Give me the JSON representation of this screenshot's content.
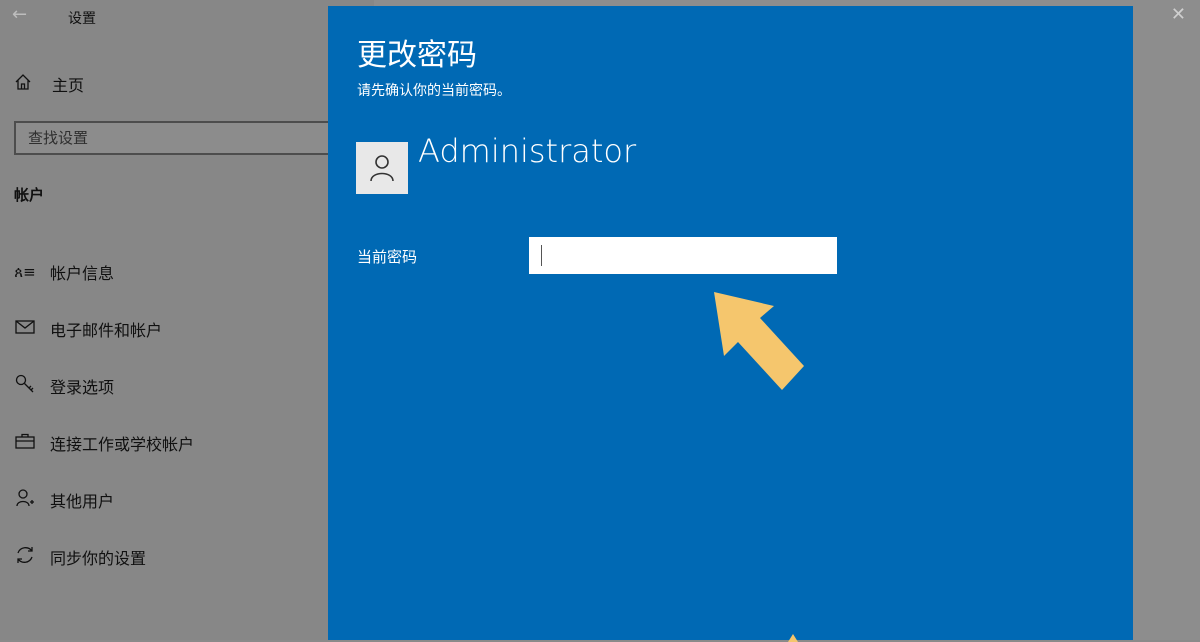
{
  "window": {
    "title": "设置",
    "back_icon": "back-arrow-icon",
    "close_icon": "close-icon"
  },
  "sidebar": {
    "home_label": "主页",
    "search_placeholder": "查找设置",
    "section_title": "帐户",
    "items": [
      {
        "icon": "account-info-icon",
        "label": "帐户信息"
      },
      {
        "icon": "mail-icon",
        "label": "电子邮件和帐户"
      },
      {
        "icon": "key-icon",
        "label": "登录选项"
      },
      {
        "icon": "briefcase-icon",
        "label": "连接工作或学校帐户"
      },
      {
        "icon": "add-user-icon",
        "label": "其他用户"
      },
      {
        "icon": "sync-icon",
        "label": "同步你的设置"
      }
    ]
  },
  "dialog": {
    "title": "更改密码",
    "subtitle": "请先确认你的当前密码。",
    "user_name": "Administrator",
    "password_label": "当前密码",
    "password_value": "",
    "background_color": "#0069b4",
    "annotation_color": "#f5c66d"
  }
}
